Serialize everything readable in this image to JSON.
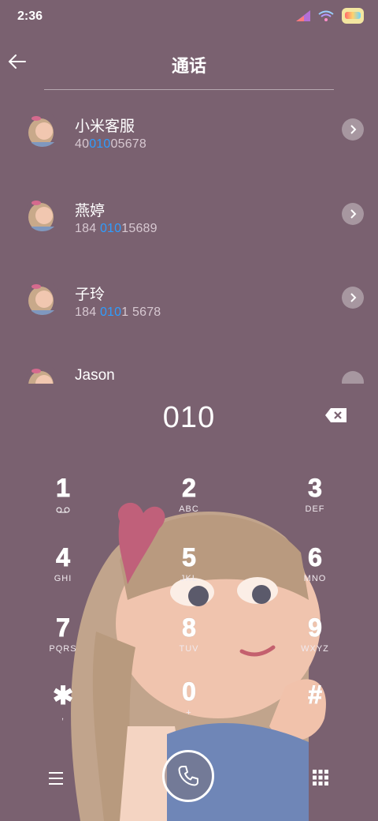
{
  "status": {
    "time": "2:36"
  },
  "header": {
    "title": "通话"
  },
  "contacts": [
    {
      "name": "小米客服",
      "pre": "40",
      "hl": "010",
      "post": "05678"
    },
    {
      "name": "燕婷",
      "pre": "184 ",
      "hl": "010",
      "post": "15689"
    },
    {
      "name": "子玲",
      "pre": "184 ",
      "hl": "010",
      "post": "1 5678"
    },
    {
      "name": "Jason",
      "pre": "",
      "hl": "",
      "post": ""
    }
  ],
  "dialer": {
    "digits": "010",
    "keys": [
      {
        "digit": "1",
        "letters": ""
      },
      {
        "digit": "2",
        "letters": "ABC"
      },
      {
        "digit": "3",
        "letters": "DEF"
      },
      {
        "digit": "4",
        "letters": "GHI"
      },
      {
        "digit": "5",
        "letters": "JKL"
      },
      {
        "digit": "6",
        "letters": "MNO"
      },
      {
        "digit": "7",
        "letters": "PQRS"
      },
      {
        "digit": "8",
        "letters": "TUV"
      },
      {
        "digit": "9",
        "letters": "WXYZ"
      },
      {
        "digit": "✱",
        "letters": ","
      },
      {
        "digit": "0",
        "letters": "+"
      },
      {
        "digit": "#",
        "letters": ""
      }
    ]
  },
  "icons": {
    "back": "back-arrow-icon",
    "backspace": "backspace-icon",
    "voicemail": "voicemail-icon",
    "call": "phone-icon",
    "menu": "menu-icon",
    "keypad": "keypad-icon"
  },
  "colors": {
    "background": "#7a6170",
    "highlight": "#2e9dff"
  }
}
